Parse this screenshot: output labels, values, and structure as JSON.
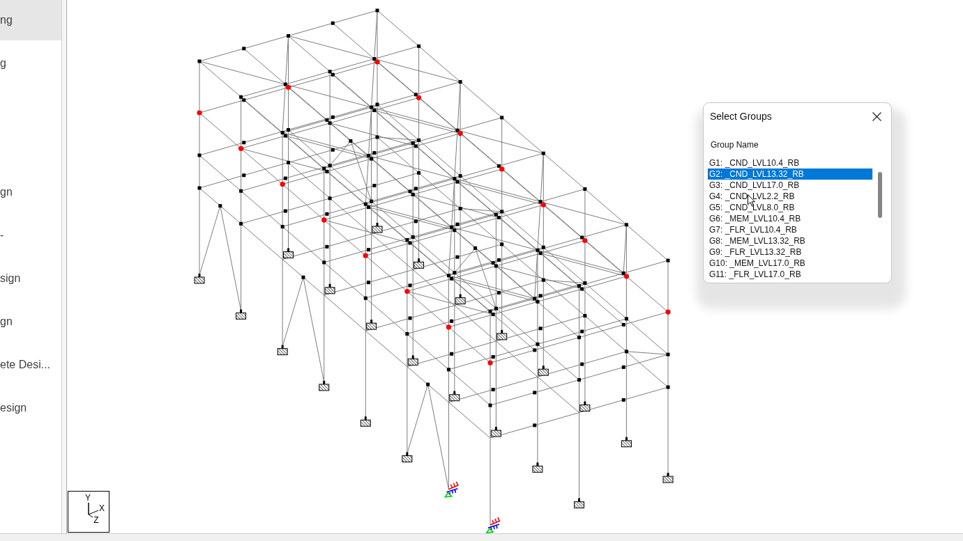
{
  "sidebar": {
    "groups": [
      {
        "items": [
          {
            "label": "ng",
            "selected": true
          },
          {
            "label": "g",
            "selected": false
          }
        ]
      },
      {
        "items": [
          {
            "label": "gn",
            "selected": false
          },
          {
            "label": "-",
            "selected": false
          },
          {
            "label": "sign",
            "selected": false
          },
          {
            "label": "gn",
            "selected": false
          },
          {
            "label": "ete Desi...",
            "selected": false
          },
          {
            "label": "esign",
            "selected": false
          }
        ]
      }
    ]
  },
  "viewport": {
    "axis_labels": [
      "Y",
      "X",
      "Z"
    ]
  },
  "dialog": {
    "title": "Select Groups",
    "column_header": "Group Name",
    "groups": [
      {
        "label": "G1: _CND_LVL10.4_RB",
        "selected": false
      },
      {
        "label": "G2: _CND_LVL13.32_RB",
        "selected": true
      },
      {
        "label": "G3: _CND_LVL17.0_RB",
        "selected": false
      },
      {
        "label": "G4: _CND_LVL2.2_RB",
        "selected": false
      },
      {
        "label": "G5: _CND_LVL8.0_RB",
        "selected": false
      },
      {
        "label": "G6: _MEM_LVL10.4_RB",
        "selected": false
      },
      {
        "label": "G7: _FLR_LVL10.4_RB",
        "selected": false
      },
      {
        "label": "G8: _MEM_LVL13.32_RB",
        "selected": false
      },
      {
        "label": "G9: _FLR_LVL13.32_RB",
        "selected": false
      },
      {
        "label": "G10: _MEM_LVL17.0_RB",
        "selected": false
      },
      {
        "label": "G11: _FLR_LVL17.0_RB",
        "selected": false
      }
    ]
  }
}
